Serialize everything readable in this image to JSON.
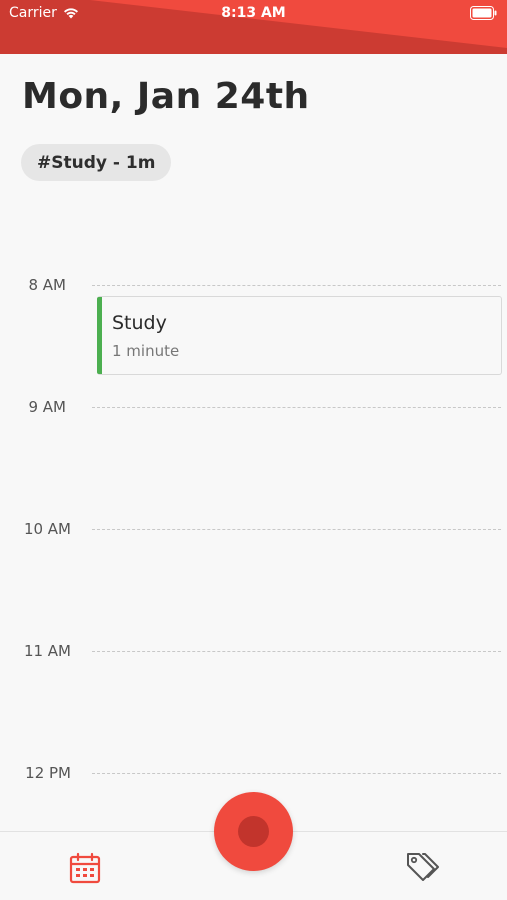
{
  "status_bar": {
    "carrier": "Carrier",
    "time": "8:13 AM",
    "battery_icon": "battery-icon",
    "wifi_icon": "wifi-icon"
  },
  "header": {
    "date": "Mon, Jan 24th"
  },
  "tag_summary": {
    "label": "#Study - 1m"
  },
  "timeline": {
    "hours": [
      "8 AM",
      "9 AM",
      "10 AM",
      "11 AM",
      "12 PM"
    ],
    "events": [
      {
        "title": "Study",
        "duration": "1 minute",
        "color": "#4caf50"
      }
    ]
  },
  "bottom_bar": {
    "left_icon": "calendar-icon",
    "right_icon": "tags-icon",
    "center_button": "record-button"
  },
  "colors": {
    "accent": "#f04a3e",
    "event_accent": "#4caf50"
  }
}
